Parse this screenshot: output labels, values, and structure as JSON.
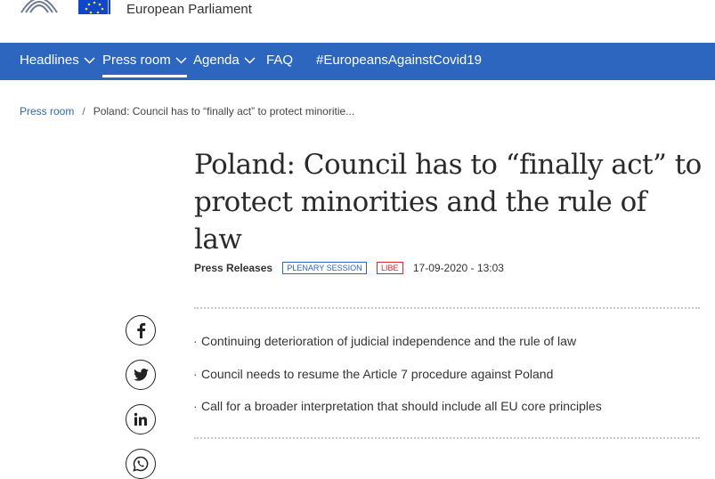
{
  "header": {
    "site_title": "European Parliament"
  },
  "nav": {
    "items": [
      {
        "label": "Headlines",
        "has_dropdown": true
      },
      {
        "label": "Press room",
        "has_dropdown": true,
        "active": true
      },
      {
        "label": "Agenda",
        "has_dropdown": true
      },
      {
        "label": "FAQ",
        "has_dropdown": false
      },
      {
        "label": "#EuropeansAgainstCovid19",
        "has_dropdown": false
      }
    ]
  },
  "breadcrumb": {
    "home": "Press room",
    "separator": "/",
    "current": "Poland: Council has to “finally act” to protect minoritie..."
  },
  "article": {
    "title": "Poland: Council has to “finally act” to protect minorities and the rule of law",
    "type": "Press Releases",
    "badges": [
      "PLENARY SESSION",
      "LIBE"
    ],
    "date": "17-09-2020 - 13:03",
    "highlights": [
      "Continuing deterioration of judicial independence and the rule of law",
      "Council needs to resume the Article 7 procedure against Poland",
      "Call for a broader interpretation that should include all EU core principles"
    ],
    "bullet": "·"
  },
  "share": {
    "icons": [
      "facebook-icon",
      "twitter-icon",
      "linkedin-icon",
      "whatsapp-icon"
    ]
  },
  "colors": {
    "nav_background": "#2D66BF",
    "eu_flag_blue": "#0E47CB",
    "eu_star_yellow": "#FFDD00",
    "link_blue": "#2D66BF",
    "badge_blue": "#2D66BF",
    "badge_red": "#D62A2A"
  }
}
